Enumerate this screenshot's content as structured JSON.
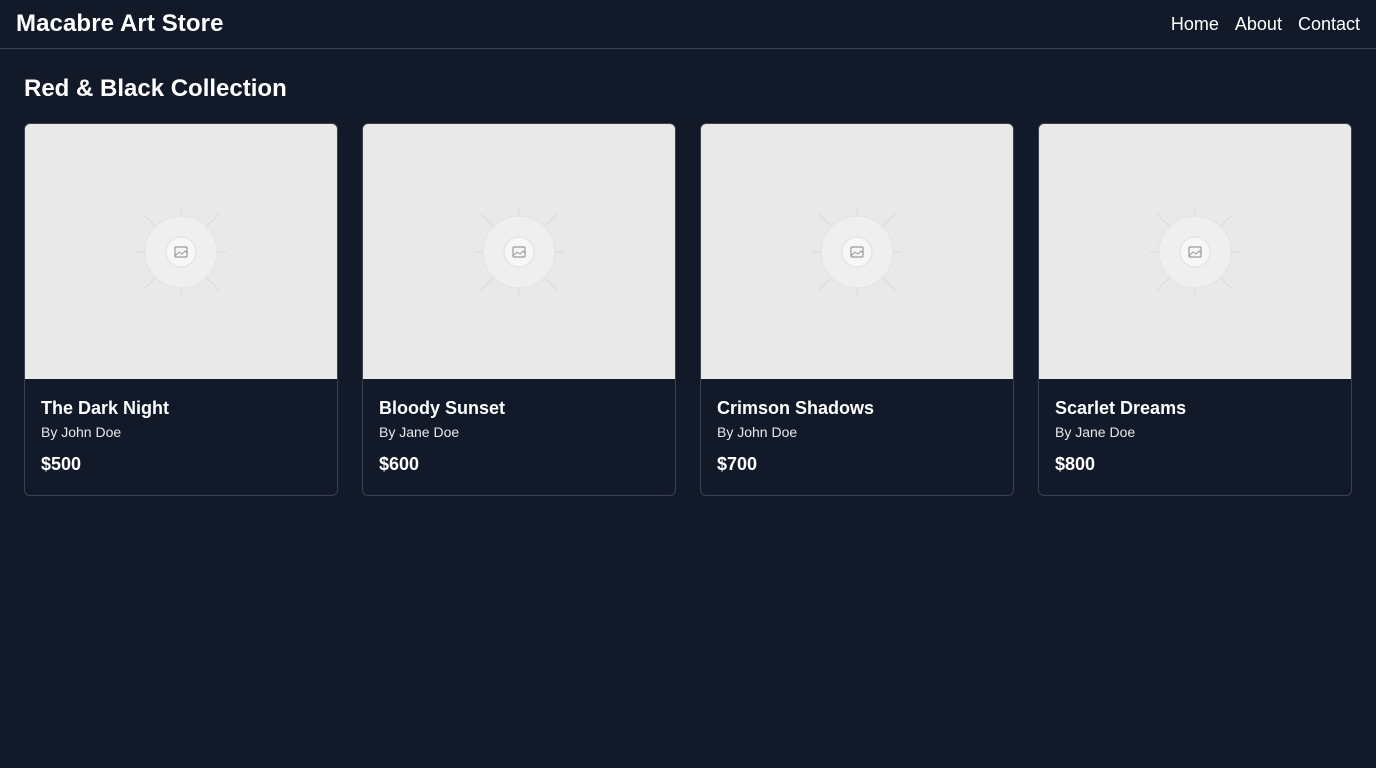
{
  "header": {
    "brand": "Macabre Art Store",
    "nav": [
      {
        "label": "Home"
      },
      {
        "label": "About"
      },
      {
        "label": "Contact"
      }
    ]
  },
  "collection": {
    "title": "Red & Black Collection",
    "items": [
      {
        "title": "The Dark Night",
        "artist": "By John Doe",
        "price": "$500",
        "image_icon": "image-placeholder-icon"
      },
      {
        "title": "Bloody Sunset",
        "artist": "By Jane Doe",
        "price": "$600",
        "image_icon": "image-placeholder-icon"
      },
      {
        "title": "Crimson Shadows",
        "artist": "By John Doe",
        "price": "$700",
        "image_icon": "image-placeholder-icon"
      },
      {
        "title": "Scarlet Dreams",
        "artist": "By Jane Doe",
        "price": "$800",
        "image_icon": "image-placeholder-icon"
      }
    ]
  },
  "colors": {
    "background": "#121928",
    "border": "#3a4150",
    "image_placeholder": "#e9e9e9",
    "text": "#ffffff"
  }
}
